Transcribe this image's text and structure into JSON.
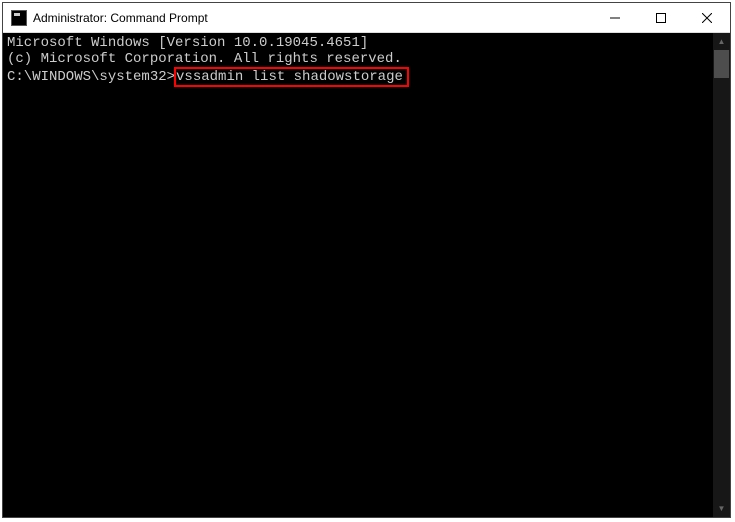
{
  "window": {
    "title": "Administrator: Command Prompt"
  },
  "console": {
    "line1": "Microsoft Windows [Version 10.0.19045.4651]",
    "line2": "(c) Microsoft Corporation. All rights reserved.",
    "blank": "",
    "prompt": "C:\\WINDOWS\\system32>",
    "command": "vssadmin list shadowstorage"
  }
}
